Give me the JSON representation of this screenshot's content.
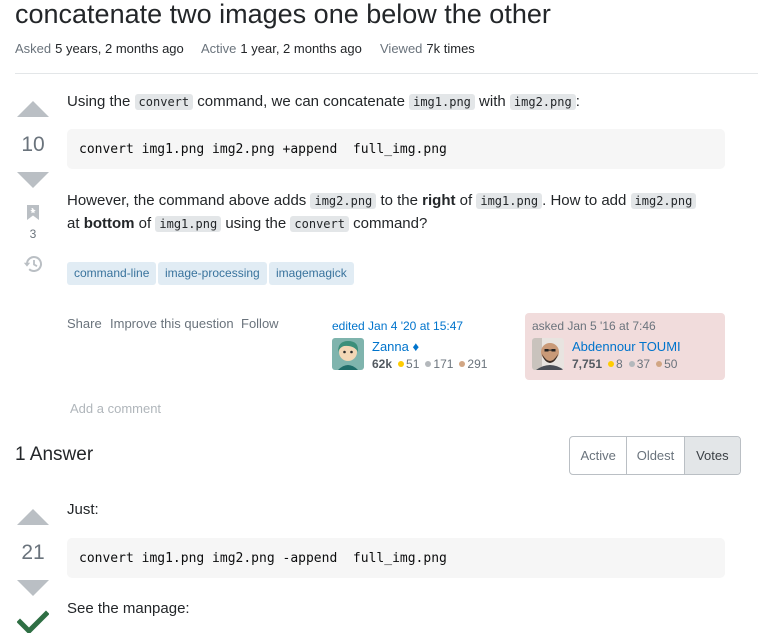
{
  "question": {
    "title": "concatenate two images one below the other",
    "asked_label": "Asked",
    "asked_value": "5 years, 2 months ago",
    "active_label": "Active",
    "active_value": "1 year, 2 months ago",
    "viewed_label": "Viewed",
    "viewed_value": "7k times",
    "score": "10",
    "bookmark_count": "3",
    "body": {
      "p1_a": "Using the ",
      "p1_code1": "convert",
      "p1_b": " command, we can concatenate ",
      "p1_code2": "img1.png",
      "p1_c": " with ",
      "p1_code3": "img2.png",
      "p1_d": ":",
      "code": "convert img1.png img2.png +append  full_img.png",
      "p2_a": "However, the command above adds ",
      "p2_code1": "img2.png",
      "p2_b": " to the ",
      "p2_strong1": "right",
      "p2_c": " of ",
      "p2_code2": "img1.png",
      "p2_d": ". How to add ",
      "p2_code3": "img2.png",
      "p3_a": "at ",
      "p3_strong": "bottom",
      "p3_b": " of ",
      "p3_code1": "img1.png",
      "p3_c": " using the ",
      "p3_code2": "convert",
      "p3_d": " command?"
    },
    "tags": [
      "command-line",
      "image-processing",
      "imagemagick"
    ],
    "menu": {
      "share": "Share",
      "improve": "Improve this question",
      "follow": "Follow"
    },
    "editor": {
      "action": "edited Jan 4 '20 at 15:47",
      "name": "Zanna",
      "mod_diamond": "♦",
      "rep": "62k",
      "gold": "51",
      "silver": "171",
      "bronze": "291"
    },
    "asker": {
      "action": "asked Jan 5 '16 at 7:46",
      "name": "Abdennour TOUMI",
      "rep": "7,751",
      "gold": "8",
      "silver": "37",
      "bronze": "50"
    },
    "add_comment": "Add a comment"
  },
  "answers": {
    "count_label": "1 Answer",
    "sort_options": [
      "Active",
      "Oldest",
      "Votes"
    ],
    "selected_sort": "Votes",
    "first": {
      "score": "21",
      "accepted": true,
      "p1": "Just:",
      "code": "convert img1.png img2.png -append  full_img.png",
      "p2": "See the manpage:"
    }
  },
  "colors": {
    "link": "#0074cc",
    "tag_bg": "#e1ecf4",
    "tag_text": "#39739d",
    "asker_card_bg": "#f1dcdc",
    "accepted_green": "#2f6f44",
    "gold": "#ffcc01",
    "silver": "#b4b8bc",
    "bronze": "#d1a684"
  },
  "icons": [
    "upvote-icon",
    "downvote-icon",
    "bookmark-icon",
    "history-icon",
    "accepted-check-icon"
  ]
}
